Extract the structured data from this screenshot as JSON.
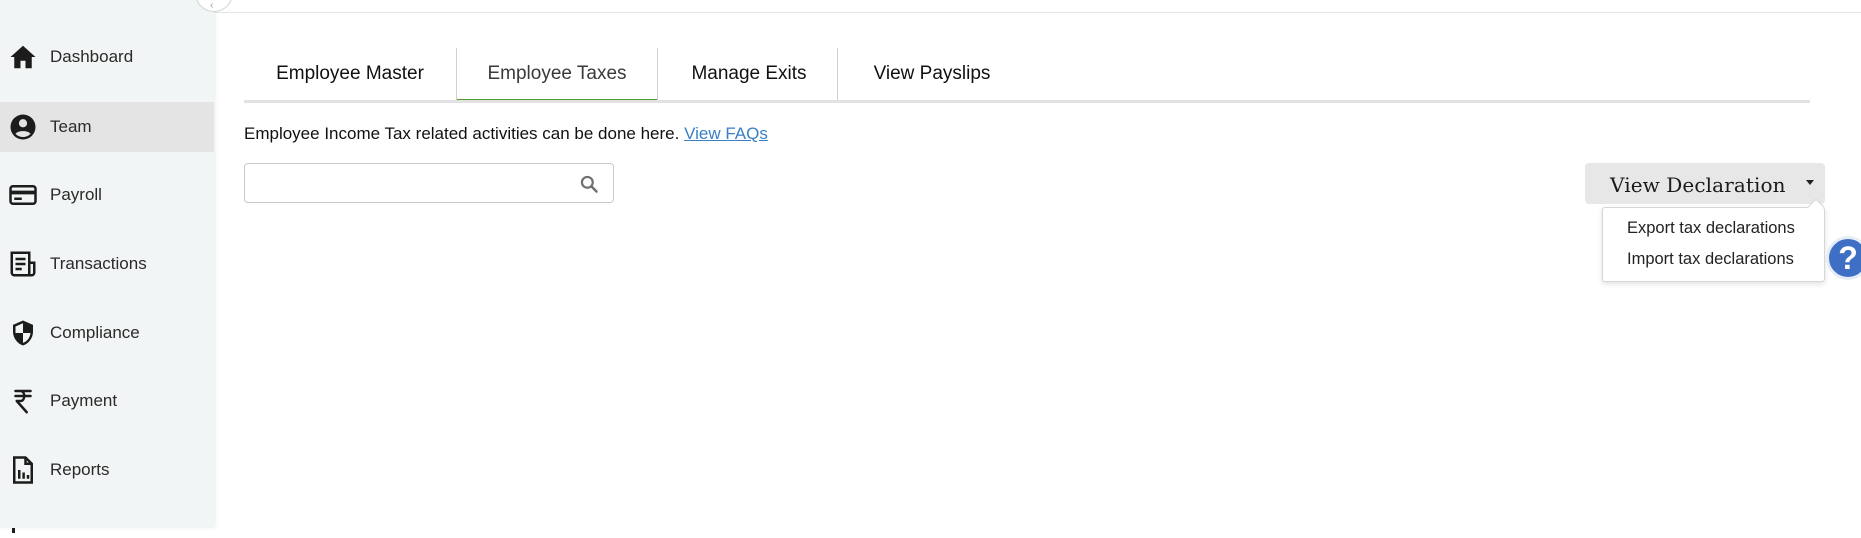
{
  "sidebar": {
    "items": [
      {
        "label": "Dashboard",
        "icon": "home-icon",
        "active": false
      },
      {
        "label": "Team",
        "icon": "user-circle-icon",
        "active": true
      },
      {
        "label": "Payroll",
        "icon": "credit-card-icon",
        "active": false
      },
      {
        "label": "Transactions",
        "icon": "receipt-icon",
        "active": false
      },
      {
        "label": "Compliance",
        "icon": "shield-icon",
        "active": false
      },
      {
        "label": "Payment",
        "icon": "rupee-icon",
        "active": false
      },
      {
        "label": "Reports",
        "icon": "report-chart-icon",
        "active": false
      }
    ]
  },
  "tabs": [
    {
      "label": "Employee Master",
      "active": false
    },
    {
      "label": "Employee Taxes",
      "active": true
    },
    {
      "label": "Manage Exits",
      "active": false
    },
    {
      "label": "View Payslips",
      "active": false
    }
  ],
  "info": {
    "text": "Employee Income Tax related activities can be done here.",
    "link": "View FAQs"
  },
  "search": {
    "value": "",
    "placeholder": ""
  },
  "view_declaration": {
    "label": "View Declaration",
    "menu": [
      "Export tax declarations",
      "Import tax declarations"
    ]
  },
  "help": {
    "glyph": "?"
  },
  "colors": {
    "accent": "#4a9c2d",
    "link": "#3a7fc4",
    "help": "#3e6fc4"
  }
}
